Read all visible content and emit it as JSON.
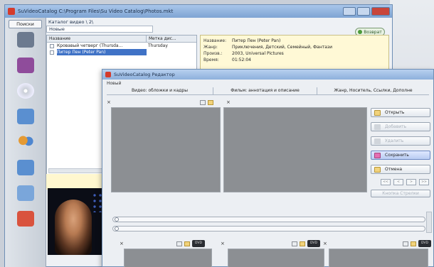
{
  "main_window": {
    "title": "SuVideoCatalog C:\\Program Files\\Su Video Catalog\\Photos.mkt",
    "left_toolbar": {
      "search_label": "Поиски",
      "tools": [
        {
          "icon": "film-reel-icon",
          "color": "#6c7a8f"
        },
        {
          "icon": "camera-icon",
          "color": "#8f4c9b"
        },
        {
          "icon": "disc-icon",
          "color": "#c9ced6"
        },
        {
          "icon": "notepad-icon",
          "color": "#5a8fd0"
        },
        {
          "icon": "people-icon",
          "color": "#d9882f"
        },
        {
          "icon": "disk-icon",
          "color": "#5a8fd0"
        },
        {
          "icon": "cubes-icon",
          "color": "#5a8fd0"
        },
        {
          "icon": "eraser-icon",
          "color": "#d9533e"
        }
      ]
    },
    "catalog": {
      "path_label": "Каталог видео \\ 2\\",
      "folder_label": "Новые",
      "return_button": "Возврат"
    },
    "list": {
      "columns": [
        "Название",
        "Метка дис..."
      ],
      "rows": [
        {
          "name": "Кровавый четверг (Thursda...",
          "mark": "Thursday",
          "selected": false
        },
        {
          "name": "Питер Пен (Peter Pan)",
          "mark": "",
          "selected": true
        }
      ]
    },
    "info": {
      "rows": [
        {
          "k": "Название:",
          "v": "Питер Пен (Peter Pan)"
        },
        {
          "k": "Жанр:",
          "v": "Приключения, Детский, Семейный, Фантази"
        },
        {
          "k": "Произв.:",
          "v": "2003, Universal Pictures"
        },
        {
          "k": "Время:",
          "v": "01:52:04"
        }
      ]
    }
  },
  "editor": {
    "title": "SuVideoCatalog Редактор",
    "sub_label": "Новый",
    "tabs": [
      "Видео: обложки и кадры",
      "Фильм: аннотация и описание",
      "Жанр, Носитель, Ссылки, Дополне"
    ],
    "dvd_label": "DVD",
    "close_glyph": "×",
    "buttons": {
      "open": "Открыть",
      "add": "Добавить",
      "remove": "Удалить",
      "save": "Сохранить",
      "cancel": "Отмена",
      "nav": [
        "<<",
        "<",
        ">",
        ">>"
      ],
      "small": "Кнопка Стрелки"
    }
  }
}
